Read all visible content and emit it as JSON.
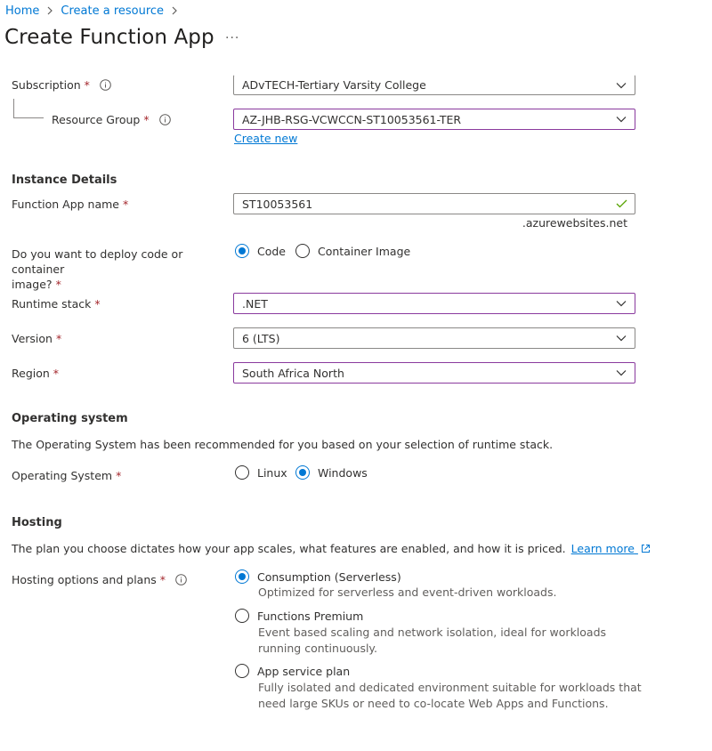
{
  "breadcrumb": {
    "home": "Home",
    "create_resource": "Create a resource"
  },
  "page": {
    "title": "Create Function App",
    "more": "···"
  },
  "project": {
    "subscription_label": "Subscription",
    "subscription_value": "ADvTECH-Tertiary Varsity College",
    "resource_group_label": "Resource Group",
    "resource_group_value": "AZ-JHB-RSG-VCWCCN-ST10053561-TER",
    "create_new": "Create new"
  },
  "instance": {
    "title": "Instance Details",
    "name_label": "Function App name",
    "name_value": "ST10053561",
    "name_suffix": ".azurewebsites.net",
    "deploy_label_line1": "Do you want to deploy code or container",
    "deploy_label_line2": "image?",
    "deploy_options": [
      "Code",
      "Container Image"
    ],
    "deploy_selected": "Code",
    "runtime_label": "Runtime stack",
    "runtime_value": ".NET",
    "version_label": "Version",
    "version_value": "6 (LTS)",
    "region_label": "Region",
    "region_value": "South Africa North"
  },
  "os": {
    "title": "Operating system",
    "description": "The Operating System has been recommended for you based on your selection of runtime stack.",
    "label": "Operating System",
    "options": [
      "Linux",
      "Windows"
    ],
    "selected": "Windows"
  },
  "hosting": {
    "title": "Hosting",
    "description": "The plan you choose dictates how your app scales, what features are enabled, and how it is priced.",
    "learn_more": "Learn more",
    "label": "Hosting options and plans",
    "plans": [
      {
        "name": "Consumption (Serverless)",
        "desc1": "Optimized for serverless and event-driven workloads.",
        "desc2": ""
      },
      {
        "name": "Functions Premium",
        "desc1": "Event based scaling and network isolation, ideal for workloads",
        "desc2": "running continuously."
      },
      {
        "name": "App service plan",
        "desc1": "Fully isolated and dedicated environment suitable for workloads that",
        "desc2": "need large SKUs or need to co-locate Web Apps and Functions."
      }
    ],
    "selected": "Consumption (Serverless)"
  },
  "required_marker": "*",
  "colors": {
    "accent": "#0078d4",
    "focus_border": "#8a3a9e",
    "required": "#a4262c",
    "valid": "#57a300"
  },
  "icons": [
    "chevron-right-icon",
    "more-icon",
    "info-icon",
    "chevron-down-icon",
    "checkmark-icon",
    "external-link-icon"
  ]
}
